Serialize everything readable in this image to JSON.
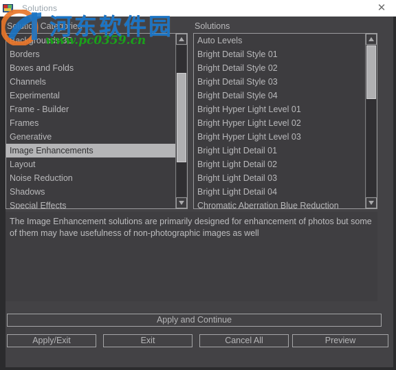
{
  "window": {
    "title": "Solutions",
    "icon": "app-icon",
    "close_label": "✕"
  },
  "columns": {
    "categories_label": "Solution Categories",
    "solutions_label": "Solutions"
  },
  "categories": {
    "selected": "Image Enhancements",
    "items": [
      "Backgrounds 3D",
      "Borders",
      "Boxes and Folds",
      "Channels",
      "Experimental",
      "Frame - Builder",
      "Frames",
      "Generative",
      "Image Enhancements",
      "Layout",
      "Noise Reduction",
      "Shadows",
      "Special Effects"
    ]
  },
  "solutions": {
    "selected": null,
    "items": [
      "Auto Levels",
      "Bright Detail Style 01",
      "Bright Detail Style 02",
      "Bright Detail Style 03",
      "Bright Detail Style 04",
      "Bright Hyper Light Level 01",
      "Bright Hyper Light Level 02",
      "Bright Hyper Light Level 03",
      "Bright Light Detail 01",
      "Bright Light Detail 02",
      "Bright Light Detail 03",
      "Bright Light Detail 04",
      "Chromatic Aberration Blue Reduction"
    ]
  },
  "description": {
    "text": "The Image Enhancement solutions are primarily designed for enhancement of photos but some of them may have usefulness of non-photographic images as well"
  },
  "buttons": {
    "apply_and_continue": "Apply and Continue",
    "apply_exit": "Apply/Exit",
    "exit": "Exit",
    "cancel_all": "Cancel All",
    "preview": "Preview"
  },
  "watermark": {
    "chinese": "河东软件园",
    "url": "www.pc0359.cn"
  },
  "colors": {
    "background": "#434245",
    "listbox_background": "#3d3c3f",
    "selection": "#b5b5b7",
    "text": "#b9b9bb",
    "border": "#9b9b9d",
    "titlebar": "#ffffff",
    "watermark_blue": "#1b74c4",
    "watermark_green": "#1aa01a"
  }
}
